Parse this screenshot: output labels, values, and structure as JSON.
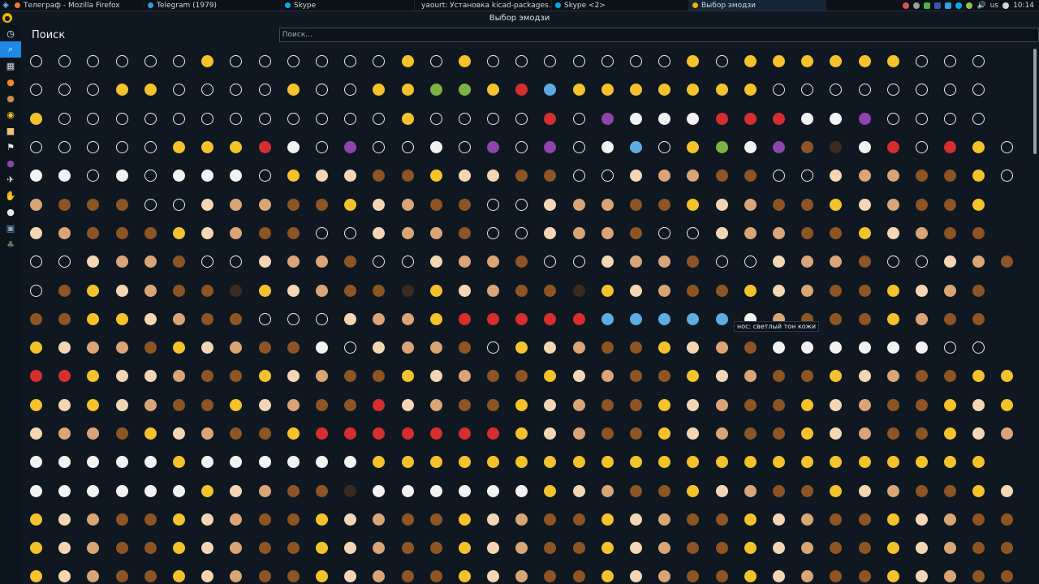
{
  "taskbar": {
    "tasks": [
      {
        "label": "Телеграф - Mozilla Firefox",
        "color": "#ff7139"
      },
      {
        "label": "Telegram (1979)",
        "color": "#2aa3df"
      },
      {
        "label": "Skype",
        "color": "#00aff0"
      },
      {
        "label": "yaourt: Установка kicad-packages...",
        "color": "#cccccc"
      },
      {
        "label": "Skype <2>",
        "color": "#00aff0"
      },
      {
        "label": "Выбор эмодзи",
        "color": "#f4b400"
      }
    ],
    "keyboard_layout": "us",
    "clock": "10:14"
  },
  "window": {
    "title": "Выбор эмодзи"
  },
  "header": {
    "title": "Поиск",
    "search_placeholder": "Поиск..."
  },
  "sidebar": {
    "categories": [
      {
        "icon": "recent-clock-icon"
      },
      {
        "icon": "search-icon"
      },
      {
        "icon": "symbols-grid-icon"
      },
      {
        "icon": "activity-pumpkin-icon"
      },
      {
        "icon": "animals-monkey-icon"
      },
      {
        "icon": "smileys-face-icon"
      },
      {
        "icon": "people-skin-tone-icon"
      },
      {
        "icon": "flags-icon"
      },
      {
        "icon": "food-grapes-icon"
      },
      {
        "icon": "travel-plane-icon"
      },
      {
        "icon": "people-hand-icon"
      },
      {
        "icon": "objects-pin-icon"
      },
      {
        "icon": "places-image-icon"
      },
      {
        "icon": "nature-tree-icon"
      }
    ]
  },
  "tooltip": {
    "text": "нос: светлый тон кожи"
  },
  "colors": {
    "accent": "#1e88e5",
    "background": "#0f1820",
    "yellow": "#f4c22b",
    "red": "#d62e2e"
  }
}
